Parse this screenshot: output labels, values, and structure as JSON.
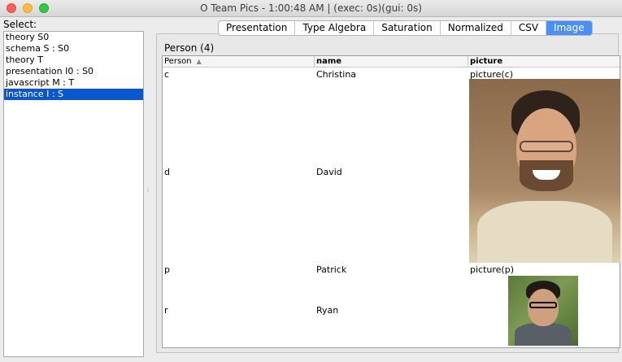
{
  "window": {
    "title": "O  Team Pics - 1:00:48 AM | (exec: 0s)(gui: 0s)"
  },
  "sidebar": {
    "label": "Select:",
    "items": [
      {
        "label": "theory S0"
      },
      {
        "label": "schema S : S0"
      },
      {
        "label": "theory T"
      },
      {
        "label": "presentation I0 : S0"
      },
      {
        "label": "javascript M : T"
      },
      {
        "label": "instance I : S",
        "selected": true
      }
    ]
  },
  "tabs": [
    {
      "label": "Presentation"
    },
    {
      "label": "Type Algebra"
    },
    {
      "label": "Saturation"
    },
    {
      "label": "Normalized"
    },
    {
      "label": "CSV"
    },
    {
      "label": "Image",
      "active": true
    }
  ],
  "table": {
    "title": "Person (4)",
    "columns": [
      "Person",
      "name",
      "picture"
    ],
    "rows": [
      {
        "id": "c",
        "name": "Christina",
        "picture": "picture(c)"
      },
      {
        "id": "d",
        "name": "David",
        "picture": ""
      },
      {
        "id": "p",
        "name": "Patrick",
        "picture": "picture(p)"
      },
      {
        "id": "r",
        "name": "Ryan",
        "picture": ""
      }
    ]
  },
  "icons": {
    "sort": "sort-ascending-icon",
    "split": "split-pane-handle-icon"
  }
}
